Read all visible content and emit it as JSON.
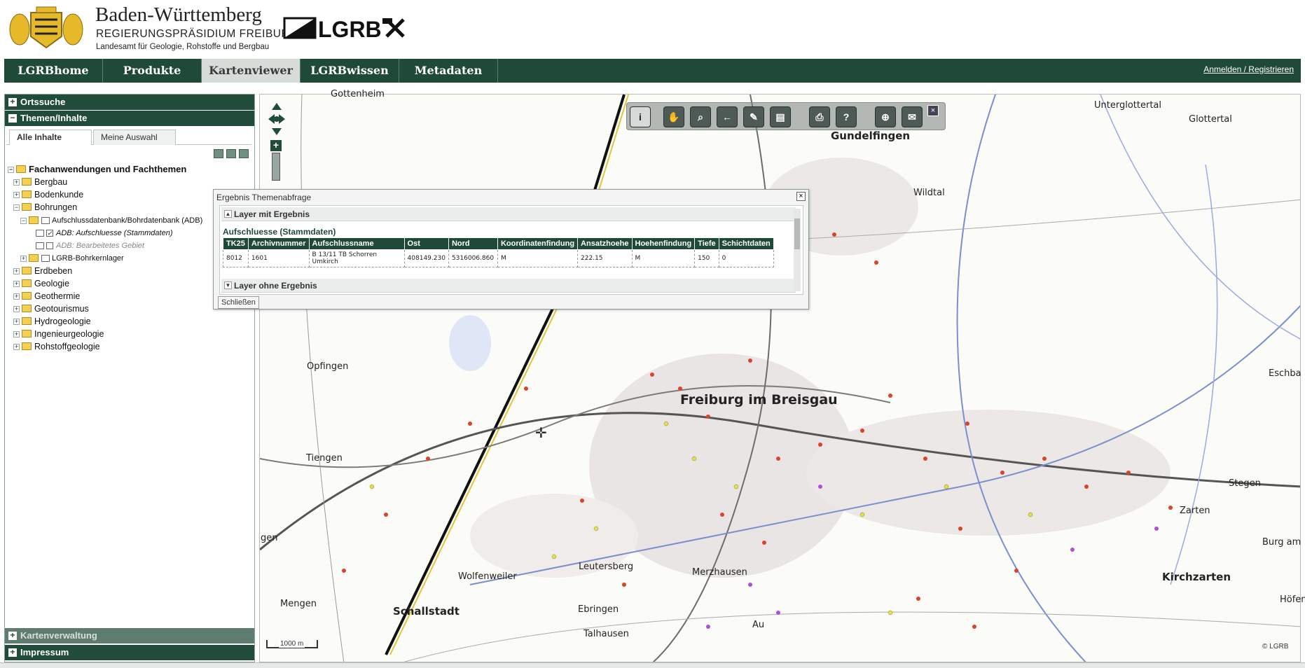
{
  "header": {
    "state": "Baden-Württemberg",
    "authority": "REGIERUNGSPRÄSIDIUM FREIBURG",
    "department": "Landesamt für Geologie, Rohstoffe und Bergbau",
    "logo_text": "LGRB"
  },
  "nav": {
    "items": [
      "LGRBhome",
      "Produkte",
      "Kartenviewer",
      "LGRBwissen",
      "Metadaten"
    ],
    "active": "Kartenviewer",
    "login": "Anmelden / Registrieren"
  },
  "sidebar": {
    "ortssuche": "Ortssuche",
    "themen": "Themen/Inhalte",
    "tabs": [
      "Alle Inhalte",
      "Meine Auswahl"
    ],
    "tree_root": "Fachanwendungen und Fachthemen",
    "tree": {
      "bergbau": "Bergbau",
      "bodenkunde": "Bodenkunde",
      "bohrungen": "Bohrungen",
      "adb": "Aufschlussdatenbank/Bohrdatenbank (ADB)",
      "adb_stamm": "ADB: Aufschluesse (Stammdaten)",
      "adb_bearb": "ADB: Bearbeitetes Gebiet",
      "bohrkern": "LGRB-Bohrkernlager",
      "erdbeben": "Erdbeben",
      "geologie": "Geologie",
      "geothermie": "Geothermie",
      "geotourismus": "Geotourismus",
      "hydrogeologie": "Hydrogeologie",
      "ingenieurgeologie": "Ingenieurgeologie",
      "rohstoffgeologie": "Rohstoffgeologie"
    },
    "kartenverwaltung": "Kartenverwaltung",
    "impressum": "Impressum"
  },
  "dialog": {
    "title": "Ergebnis Themenabfrage",
    "section_with": "Layer mit Ergebnis",
    "layer_title": "Aufschluesse (Stammdaten)",
    "columns": [
      "TK25",
      "Archivnummer",
      "Aufschlussname",
      "Ost",
      "Nord",
      "Koordinatenfindung",
      "Ansatzhoehe",
      "Hoehenfindung",
      "Tiefe",
      "Schichtdaten"
    ],
    "row": [
      "8012",
      "1601",
      "B 13/11 TB Schorren Umkirch",
      "408149.230",
      "5316006.860",
      "M",
      "222.15",
      "M",
      "150",
      "0"
    ],
    "section_without": "Layer ohne Ergebnis",
    "close_button": "Schließen"
  },
  "map": {
    "places": {
      "gottenheim": "Gottenheim",
      "gundelfingen": "Gundelfingen",
      "wildtal": "Wildtal",
      "unterglottertal": "Unterglottertal",
      "glottertal": "Glottertal",
      "opfingen": "Opfingen",
      "freiburg": "Freiburg im Breisgau",
      "eschbach": "Eschba",
      "tiengen": "Tiengen",
      "stegen": "Stegen",
      "zarten": "Zarten",
      "burg": "Burg am",
      "gen": "gen",
      "wolfenweiler": "Wolfenweiler",
      "leutersberg": "Leutersberg",
      "merzhausen": "Merzhausen",
      "kirchzarten": "Kirchzarten",
      "mengen": "Mengen",
      "schallstadt": "Schallstadt",
      "ebringen": "Ebringen",
      "au": "Au",
      "hofen": "Höfen",
      "talhausen": "Talhausen"
    },
    "scale": "1000 m",
    "copyright": "© LGRB"
  },
  "icons": {
    "close": "close-icon",
    "info": "info-icon",
    "pan": "hand-icon",
    "zoom": "magnifier-icon",
    "back": "back-icon",
    "edit": "pencil-icon",
    "print": "printer-icon",
    "help": "help-icon"
  },
  "colors": {
    "nav_bg": "#1f4a37",
    "accent": "#204c39"
  }
}
